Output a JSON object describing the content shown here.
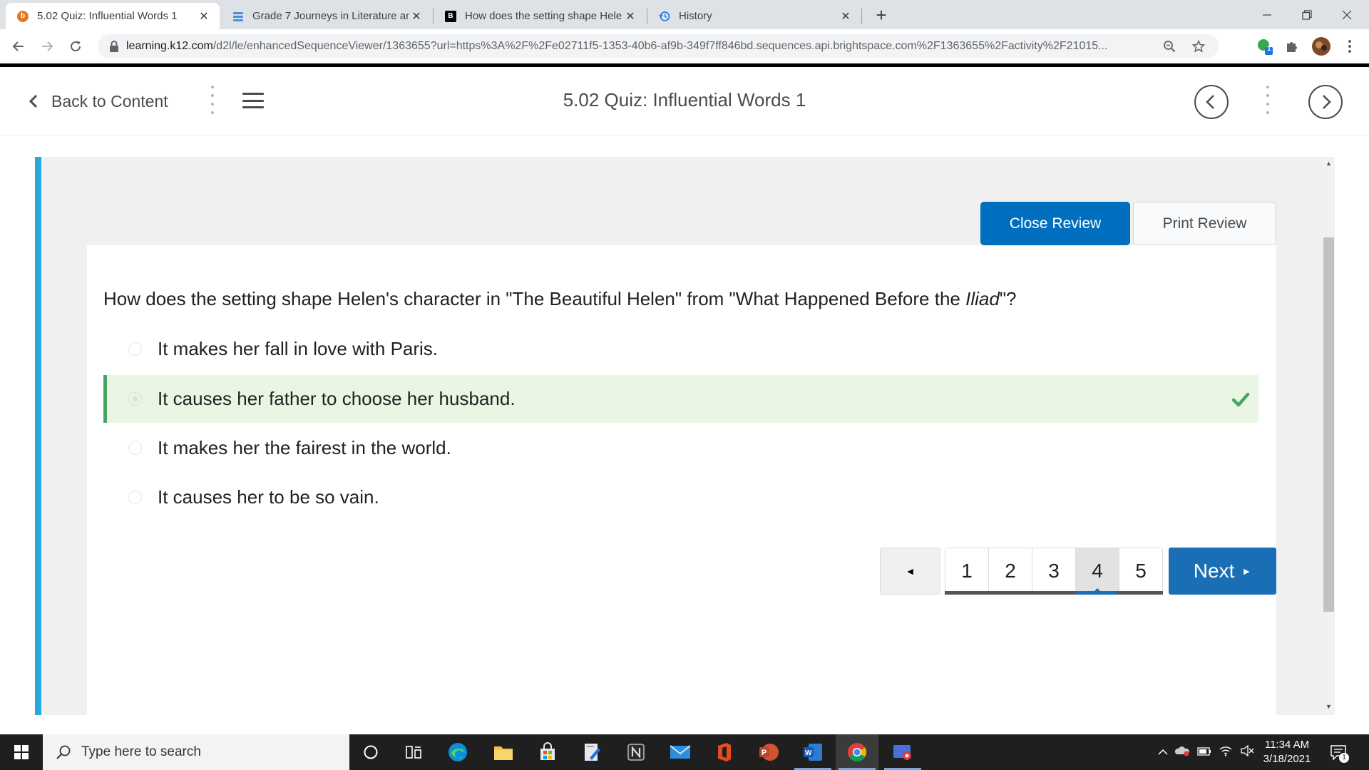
{
  "browser": {
    "tabs": [
      {
        "title": "5.02 Quiz: Influential Words 1",
        "icon": "brightspace-icon",
        "active": true
      },
      {
        "title": "Grade 7 Journeys in Literature an",
        "icon": "stack-icon",
        "active": false
      },
      {
        "title": "How does the setting shape Hele",
        "icon": "brainly-icon",
        "active": false
      },
      {
        "title": "History",
        "icon": "history-icon",
        "active": false
      }
    ],
    "url_host": "learning.k12.com",
    "url_path": "/d2l/le/enhancedSequenceViewer/1363655?url=https%3A%2F%2Fe02711f5-1353-40b6-af9b-349f7ff846bd.sequences.api.brightspace.com%2F1363655%2Factivity%2F21015...",
    "extension_badge": "1"
  },
  "header": {
    "back_label": "Back to Content",
    "title": "5.02 Quiz: Influential Words 1"
  },
  "review": {
    "close_label": "Close Review",
    "print_label": "Print Review"
  },
  "question": {
    "text_before": "How does the setting shape Helen's character in \"The Beautiful Helen\" from \"What Happened Before the ",
    "text_italic": "Iliad",
    "text_after": "\"?",
    "choices": [
      {
        "label": "It makes her fall in love with Paris.",
        "selected": false,
        "correct": false
      },
      {
        "label": "It causes her father to choose her husband.",
        "selected": true,
        "correct": true
      },
      {
        "label": "It makes her the fairest in the world.",
        "selected": false,
        "correct": false
      },
      {
        "label": "It causes her to be so vain.",
        "selected": false,
        "correct": false
      }
    ]
  },
  "pagination": {
    "prev_symbol": "◄",
    "pages": [
      "1",
      "2",
      "3",
      "4",
      "5"
    ],
    "current_page": "4",
    "next_label": "Next",
    "next_symbol": "►"
  },
  "taskbar": {
    "search_placeholder": "Type here to search",
    "time": "11:34 AM",
    "date": "3/18/2021",
    "notification_count": "1"
  },
  "colors": {
    "accent_blue": "#006fbf",
    "correct_green": "#46a661",
    "correct_bg": "#eaf6e3",
    "frame_bar": "#29a8e0"
  }
}
